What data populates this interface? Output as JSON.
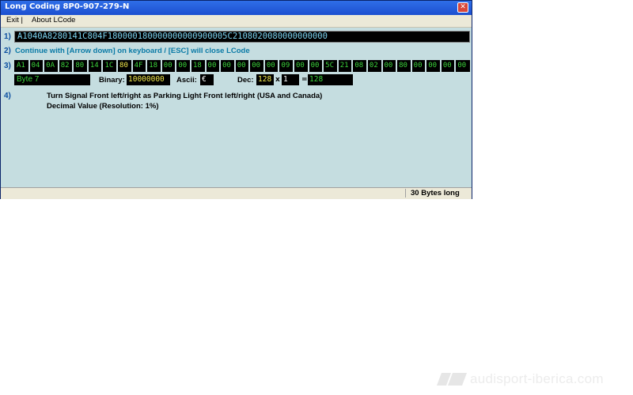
{
  "window": {
    "title": "Long Coding  8P0-907-279-N",
    "close_glyph": "✕"
  },
  "menu": {
    "items": [
      "Exit |",
      "About LCode"
    ]
  },
  "step_labels": [
    "1)",
    "2)",
    "3)",
    "4)"
  ],
  "coding_string": "A1040A8280141C804F180000180000000000900005C2108020080000000000",
  "hint": "Continue with [Arrow down] on keyboard / [ESC] will close LCode",
  "bytes": [
    "A1",
    "04",
    "0A",
    "82",
    "80",
    "14",
    "1C",
    "80",
    "4F",
    "18",
    "00",
    "00",
    "18",
    "00",
    "00",
    "00",
    "00",
    "00",
    "09",
    "00",
    "00",
    "5C",
    "21",
    "08",
    "02",
    "00",
    "80",
    "00",
    "00",
    "00",
    "00"
  ],
  "selected_byte_index": 7,
  "byte_info": {
    "byte_label": "Byte 7",
    "binary_label": "Binary:",
    "binary_value": "10000000",
    "ascii_label": "Ascii:",
    "ascii_value": "€",
    "dec_label": "Dec:",
    "dec_value": "128",
    "times": "x",
    "multiplier": "1",
    "equals": "=",
    "result": "128"
  },
  "description": {
    "line1": "Turn Signal Front left/right as Parking Light Front left/right (USA and Canada)",
    "line2": "Decimal Value (Resolution: 1%)"
  },
  "status": {
    "text": "30 Bytes long"
  },
  "watermark": {
    "text": "audisport-iberica.com"
  }
}
